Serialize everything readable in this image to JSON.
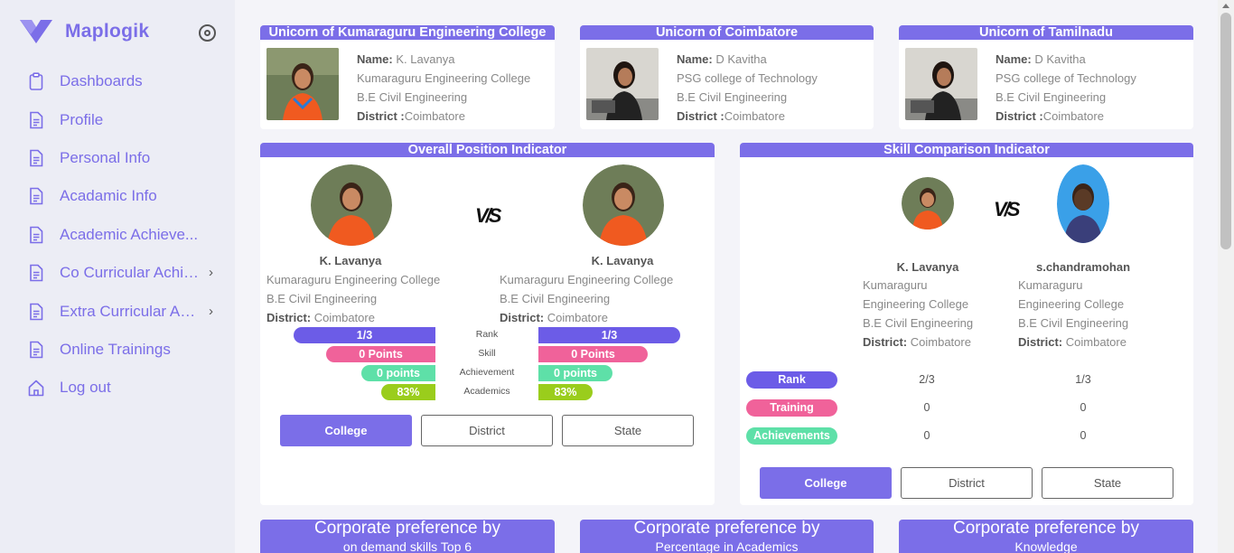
{
  "brand": {
    "name": "Maplogik"
  },
  "sidebar": {
    "items": [
      {
        "label": "Dashboards",
        "icon": "clipboard-icon"
      },
      {
        "label": "Profile",
        "icon": "document-icon"
      },
      {
        "label": "Personal Info",
        "icon": "document-icon"
      },
      {
        "label": "Acadamic Info",
        "icon": "document-icon"
      },
      {
        "label": "Academic Achieve...",
        "icon": "document-icon"
      },
      {
        "label": "Co Curricular Achie...",
        "icon": "document-icon",
        "has_submenu": true
      },
      {
        "label": "Extra Curricular Act...",
        "icon": "document-icon",
        "has_submenu": true
      },
      {
        "label": "Online Trainings",
        "icon": "document-icon"
      },
      {
        "label": "Log out",
        "icon": "home-icon"
      }
    ]
  },
  "unicorns": [
    {
      "title": "Unicorn of Kumaraguru Engineering College",
      "name_label": "Name:",
      "name": "K. Lavanya",
      "college": "Kumaraguru Engineering College",
      "dept": "B.E Civil Engineering",
      "district_label": "District :",
      "district": "Coimbatore"
    },
    {
      "title": "Unicorn of Coimbatore",
      "name_label": "Name:",
      "name": "D Kavitha",
      "college": "PSG college of Technology",
      "dept": "B.E Civil Engineering",
      "district_label": "District :",
      "district": "Coimbatore"
    },
    {
      "title": "Unicorn of Tamilnadu",
      "name_label": "Name:",
      "name": "D Kavitha",
      "college": "PSG college of Technology",
      "dept": "B.E Civil Engineering",
      "district_label": "District :",
      "district": "Coimbatore"
    }
  ],
  "overall": {
    "title": "Overall Position Indicator",
    "vs": "V/S",
    "left": {
      "name": "K. Lavanya",
      "college": "Kumaraguru Engineering College",
      "dept": "B.E Civil Engineering",
      "district_label": "District:",
      "district": "Coimbatore"
    },
    "right": {
      "name": "K. Lavanya",
      "college": "Kumaraguru Engineering College",
      "dept": "B.E Civil Engineering",
      "district_label": "District:",
      "district": "Coimbatore"
    },
    "metrics": [
      {
        "label": "Rank",
        "left": "1/3",
        "right": "1/3",
        "color": "#6c5ce7"
      },
      {
        "label": "Skill",
        "left": "0 Points",
        "right": "0 Points",
        "color": "#f0629a"
      },
      {
        "label": "Achievement",
        "left": "0 points",
        "right": "0 points",
        "color": "#5ee0a8"
      },
      {
        "label": "Academics",
        "left": "83%",
        "right": "83%",
        "color": "#9acd1c"
      }
    ],
    "buttons": [
      "College",
      "District",
      "State"
    ]
  },
  "skill": {
    "title": "Skill Comparison Indicator",
    "vs": "V/S",
    "left": {
      "name": "K. Lavanya",
      "college_1": "Kumaraguru",
      "college_2": "Engineering College",
      "dept": "B.E Civil Engineering",
      "district_label": "District:",
      "district": "Coimbatore"
    },
    "right": {
      "name": "s.chandramohan",
      "college_1": "Kumaraguru",
      "college_2": "Engineering College",
      "dept": "B.E Civil Engineering",
      "district_label": "District:",
      "district": "Coimbatore"
    },
    "rows": [
      {
        "label": "Rank",
        "left": "2/3",
        "right": "1/3",
        "color": "#6c5ce7"
      },
      {
        "label": "Training",
        "left": "0",
        "right": "0",
        "color": "#f0629a"
      },
      {
        "label": "Achievements",
        "left": "0",
        "right": "0",
        "color": "#5ee0a8"
      }
    ],
    "buttons": [
      "College",
      "District",
      "State"
    ]
  },
  "corporate": [
    {
      "title": "Corporate preference by",
      "subtitle": "on demand skills Top 6"
    },
    {
      "title": "Corporate preference by",
      "subtitle": "Percentage in Academics"
    },
    {
      "title": "Corporate preference by",
      "subtitle": "Knowledge"
    }
  ],
  "colors": {
    "accent": "#7b6ee8",
    "rank": "#6c5ce7",
    "skill": "#f0629a",
    "achievement": "#5ee0a8",
    "academics": "#9acd1c"
  }
}
